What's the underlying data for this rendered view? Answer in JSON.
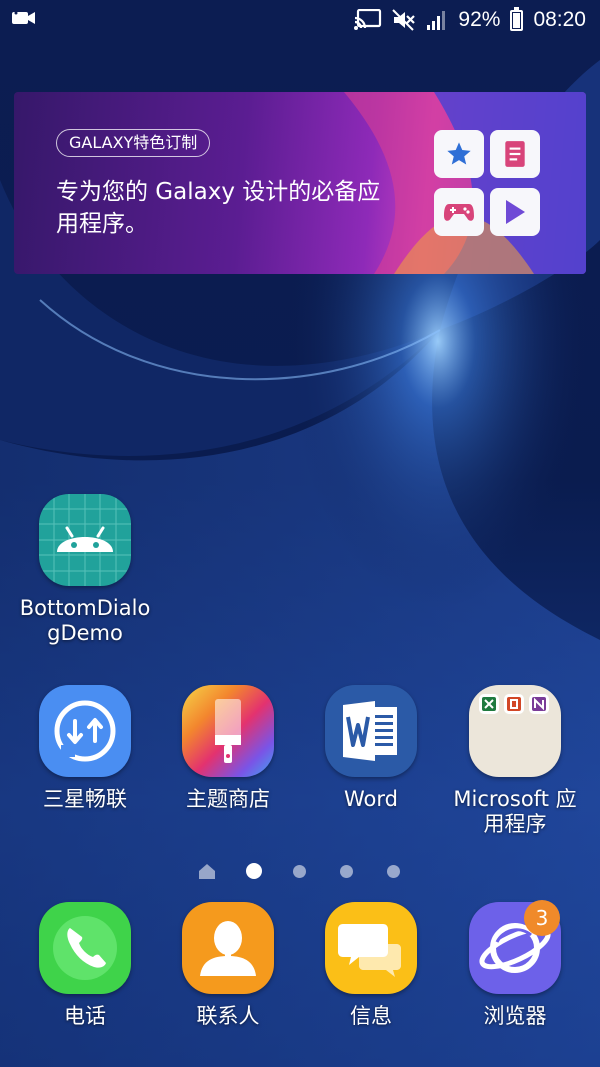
{
  "status_bar": {
    "battery_percent": "92%",
    "battery_level": 0.92,
    "time": "08:20",
    "icons": [
      "video-camera-icon",
      "screen-cast-icon",
      "mute-icon",
      "signal-icon",
      "battery-icon"
    ]
  },
  "widget": {
    "pill_label": "GALAXY特色订制",
    "description": "专为您的 Galaxy 设计的必备应用程序。",
    "tiles": [
      "star-icon",
      "document-icon",
      "gamepad-icon",
      "play-icon"
    ],
    "colors": {
      "star": "#2f6fd6",
      "document": "#d8447a",
      "gamepad": "#d8447a",
      "play": "#6f4ad6"
    }
  },
  "apps": {
    "bottom_dialog_demo": "BottomDialo\ngDemo",
    "samsung_flow": "三星畅联",
    "theme_store": "主题商店",
    "word": "Word",
    "microsoft_apps": "Microsoft 应\n用程序"
  },
  "pager": {
    "page_count": 4,
    "active_index": 1,
    "has_home_page": true
  },
  "dock": {
    "phone": "电话",
    "contacts": "联系人",
    "messages": "信息",
    "browser": "浏览器",
    "browser_badge": "3"
  }
}
